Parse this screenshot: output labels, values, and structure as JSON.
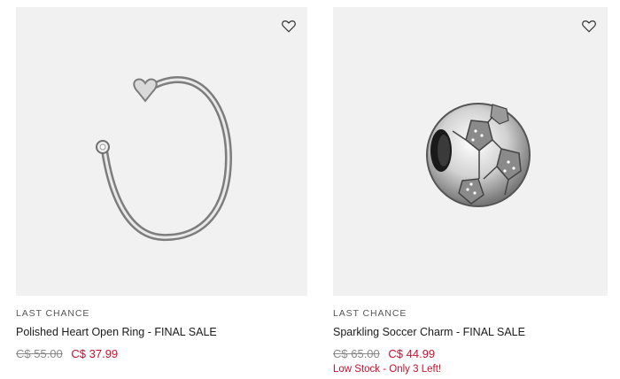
{
  "products": [
    {
      "eyebrow": "LAST CHANCE",
      "title": "Polished Heart Open Ring - FINAL SALE",
      "old_price": "C$ 55.00",
      "new_price": "C$ 37.99",
      "stock": "",
      "image_icon": "heart-open-ring-image",
      "wishlist_icon": "heart-outline-icon"
    },
    {
      "eyebrow": "LAST CHANCE",
      "title": "Sparkling Soccer Charm - FINAL SALE",
      "old_price": "C$ 65.00",
      "new_price": "C$ 44.99",
      "stock": "Low Stock - Only 3 Left!",
      "image_icon": "soccer-charm-image",
      "wishlist_icon": "heart-outline-icon"
    }
  ],
  "colors": {
    "image_bg": "#f1f1f1",
    "sale_red": "#c8102e",
    "muted_gray": "#8a8a8a"
  }
}
